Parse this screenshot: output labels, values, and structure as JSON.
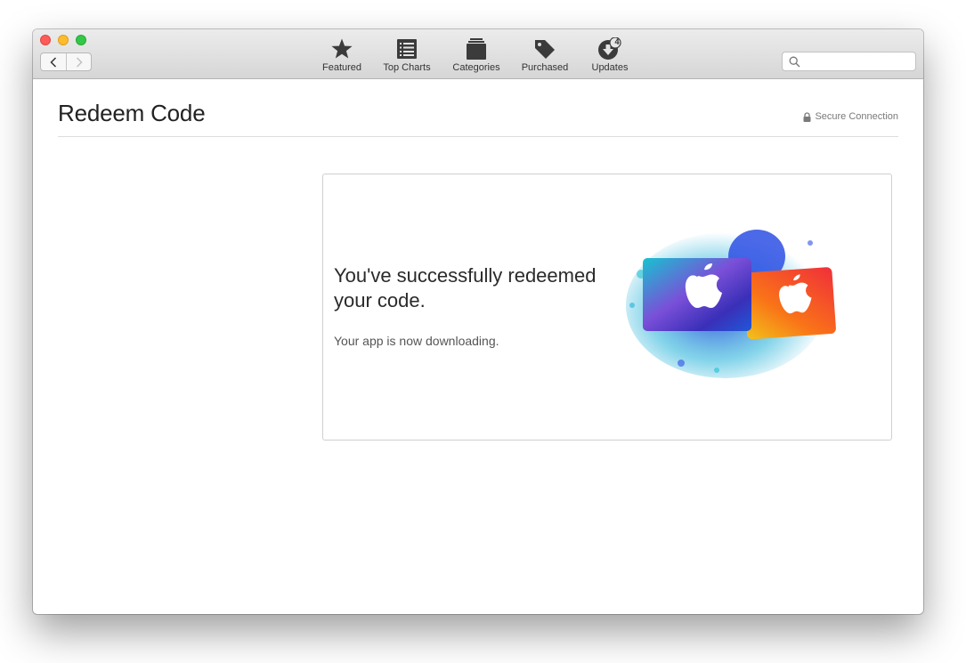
{
  "toolbar": {
    "tabs": [
      {
        "id": "featured",
        "label": "Featured",
        "icon": "star-icon"
      },
      {
        "id": "top-charts",
        "label": "Top Charts",
        "icon": "list-icon"
      },
      {
        "id": "categories",
        "label": "Categories",
        "icon": "stack-icon"
      },
      {
        "id": "purchased",
        "label": "Purchased",
        "icon": "tag-icon"
      },
      {
        "id": "updates",
        "label": "Updates",
        "icon": "download-icon",
        "badge": "4"
      }
    ],
    "search": {
      "placeholder": ""
    }
  },
  "page": {
    "title": "Redeem Code",
    "secure_label": "Secure Connection"
  },
  "card": {
    "heading": "You've successfully redeemed your code.",
    "subtext": "Your app is now downloading."
  },
  "colors": {
    "close": "#fc5b57",
    "minimize": "#fdbc2e",
    "maximize": "#33c748",
    "icon": "#3b3b3b"
  }
}
